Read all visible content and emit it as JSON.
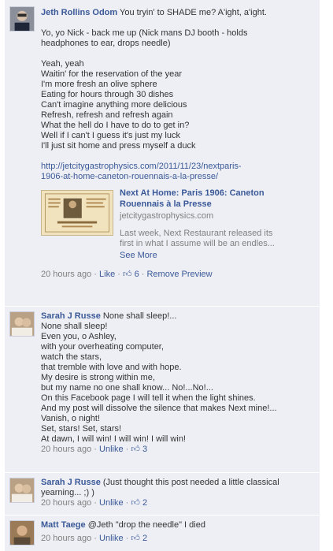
{
  "comments": [
    {
      "author": "Jeth Rollins Odom",
      "first_line": "You tryin' to SHADE me? A'ight, a'ight.",
      "lines": [
        "",
        "Yo, yo Nick - back me up (Nick mans DJ booth - holds",
        "headphones to ear, drops needle)",
        "",
        "Yeah, yeah",
        "Waitin' for the reservation of the year",
        "I'm more fresh an olive sphere",
        "Eating for hours through 30 dishes",
        "Can't imagine anything more delicious",
        "Refresh, refresh and refresh again",
        "What the hell do I have to do to get in?",
        "Well if I can't I guess it's just my luck",
        "I'll just sit home and press myself a duck",
        ""
      ],
      "link_lines": [
        "http://jetcitygastrophysics.com/2011/11/23/nextparis-",
        "1906-at-home-caneton-rouennais-a-la-presse/"
      ],
      "preview": {
        "title_lines": [
          "Next At Home: Paris 1906: Caneton",
          "Rouennais à la Presse"
        ],
        "domain": "jetcitygastrophysics.com",
        "desc_lines": [
          "Last week, Next Restaurant released its",
          "first in what I assume will be an endles..."
        ],
        "more": "See More"
      },
      "meta": {
        "time": "20 hours ago",
        "sep": "·",
        "like": "Like",
        "likes": "6",
        "extra": "Remove Preview"
      }
    },
    {
      "author": "Sarah J Russe",
      "first_line": "None shall sleep!...",
      "lines": [
        "None shall sleep!",
        "Even you, o Ashley,",
        "with your overheating computer,",
        "watch the stars,",
        "that tremble with love and with hope.",
        "My desire is strong within me,",
        "but my name no one shall know... No!...No!...",
        "On this Facebook page I will tell it when the light shines.",
        "And my post will dissolve the silence that makes Next mine!...",
        "Vanish, o night!",
        "Set, stars! Set, stars!",
        "At dawn, I will win! I will win! I will win!"
      ],
      "meta": {
        "time": "20 hours ago",
        "sep": "·",
        "like": "Unlike",
        "likes": "3"
      }
    },
    {
      "author": "Sarah J Russe",
      "first_line": "(Just thought this post needed a little classical",
      "lines": [
        "yearning... ;) )"
      ],
      "meta": {
        "time": "20 hours ago",
        "sep": "·",
        "like": "Unlike",
        "likes": "2"
      }
    },
    {
      "author": "Matt Taege",
      "first_line": "@Jeth \"drop the needle\" I died",
      "lines": [],
      "meta": {
        "time": "20 hours ago",
        "sep": "·",
        "like": "Unlike",
        "likes": "2"
      }
    }
  ],
  "colors": {
    "background": "#edeff4",
    "link": "#3b5998",
    "meta": "#808080"
  },
  "icons": {
    "likes": "thumbs-up-icon"
  }
}
